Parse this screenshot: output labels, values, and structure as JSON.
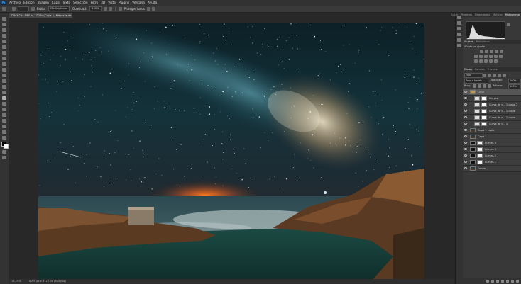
{
  "menu": {
    "logo": "Ps",
    "items": [
      "Archivo",
      "Edición",
      "Imagen",
      "Capa",
      "Texto",
      "Selección",
      "Filtro",
      "3D",
      "Vista",
      "Plugins",
      "Ventana",
      "Ayuda"
    ]
  },
  "options": {
    "style_label": "Estilo:",
    "style_value": "Medios tonos",
    "opacity_label": "Opacidad:",
    "opacity_value": "100%",
    "protect_label": "Proteger tonos"
  },
  "document": {
    "tab_title": "DSC8224.NEF al 17,2% (Copa 1, Máscara de capa/8) *",
    "zoom": "16,19%",
    "size_info": "6000 px x 3712 px (300 ppp)"
  },
  "panels": {
    "top_tabs": [
      "Color",
      "Muestras",
      "Degradados",
      "Motivos",
      "Histograma"
    ],
    "active_top_tab": 4,
    "adjust_tabs": [
      "Ajustes",
      "Bibliotecas"
    ],
    "add_adjustment_label": "Añadir un ajuste",
    "layer_tabs": [
      "Capas",
      "Canales",
      "Trazados"
    ],
    "filter_placeholder": "Tipo",
    "blend_mode": "Paso a través",
    "opacity_label": "Opacidad:",
    "opacity_value": "100%",
    "lock_label": "Bloq:",
    "fill_label": "Relleno:",
    "fill_value": "100%"
  },
  "layers": [
    {
      "name": "Cielo",
      "indent": 0,
      "kind": "group",
      "selected": true
    },
    {
      "name": "Curvas",
      "indent": 1,
      "kind": "adj"
    },
    {
      "name": "Curva de c... 1 copia 2",
      "indent": 1,
      "kind": "adj"
    },
    {
      "name": "Curva de c... 1 copia",
      "indent": 1,
      "kind": "adj"
    },
    {
      "name": "Curva de c... 1 copia",
      "indent": 1,
      "kind": "adj"
    },
    {
      "name": "Curva de c... 1",
      "indent": 1,
      "kind": "adj"
    },
    {
      "name": "Copa 1 copia",
      "indent": 0,
      "kind": "photo"
    },
    {
      "name": "Capa 1",
      "indent": 0,
      "kind": "photo"
    },
    {
      "name": "Curvas 4",
      "indent": 0,
      "kind": "mask"
    },
    {
      "name": "Curvas 3",
      "indent": 0,
      "kind": "mask"
    },
    {
      "name": "Curvas 2",
      "indent": 0,
      "kind": "mask"
    },
    {
      "name": "Curvas 1",
      "indent": 0,
      "kind": "mask"
    },
    {
      "name": "Fondo",
      "indent": 0,
      "kind": "photo"
    }
  ],
  "colors": {
    "chrome": "#323232",
    "panel": "#383838",
    "selected_layer": "#565656",
    "accent": "#31a8ff"
  }
}
